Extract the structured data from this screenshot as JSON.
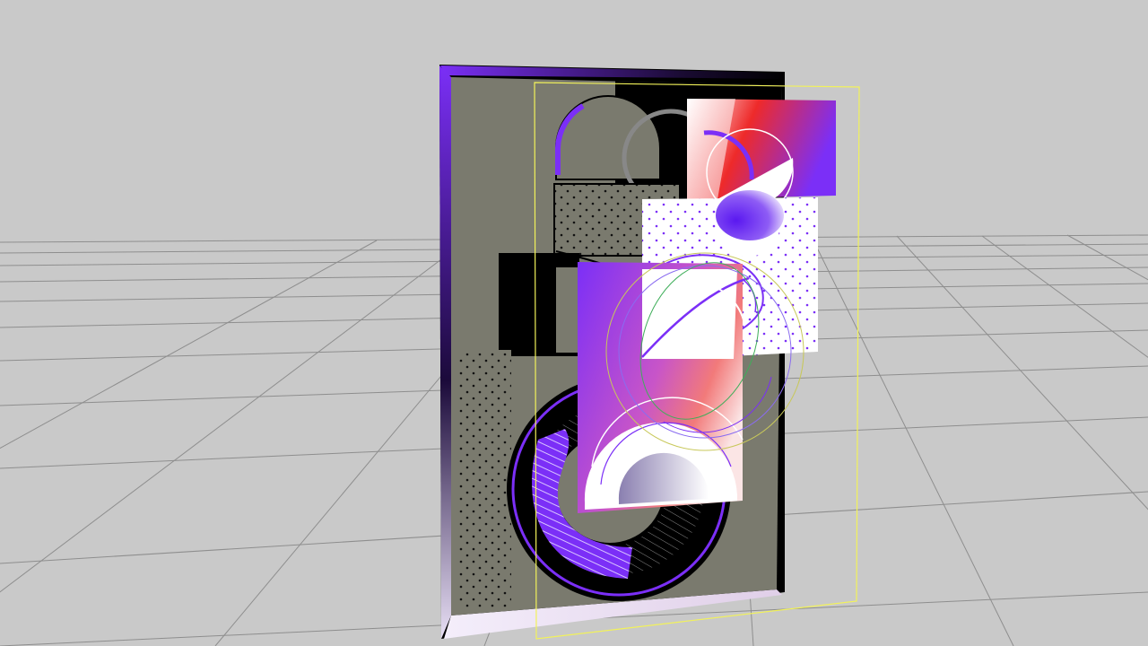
{
  "viewport": {
    "background": "#c9c9c9",
    "grid_color": "#8e8e8e",
    "selection_color": "#f2f25a"
  },
  "artwork": {
    "panel_fill": "#7a7a6e",
    "accent_purple": "#7b2ff7",
    "accent_red": "#ee2a2a",
    "accent_white": "#ffffff",
    "accent_black": "#000000"
  },
  "icons": {
    "background_panel": "panel-icon",
    "gradient_card": "gradient-card-icon",
    "dotted_card": "dotted-card-icon",
    "hatched_ring": "hatched-ring-icon"
  }
}
